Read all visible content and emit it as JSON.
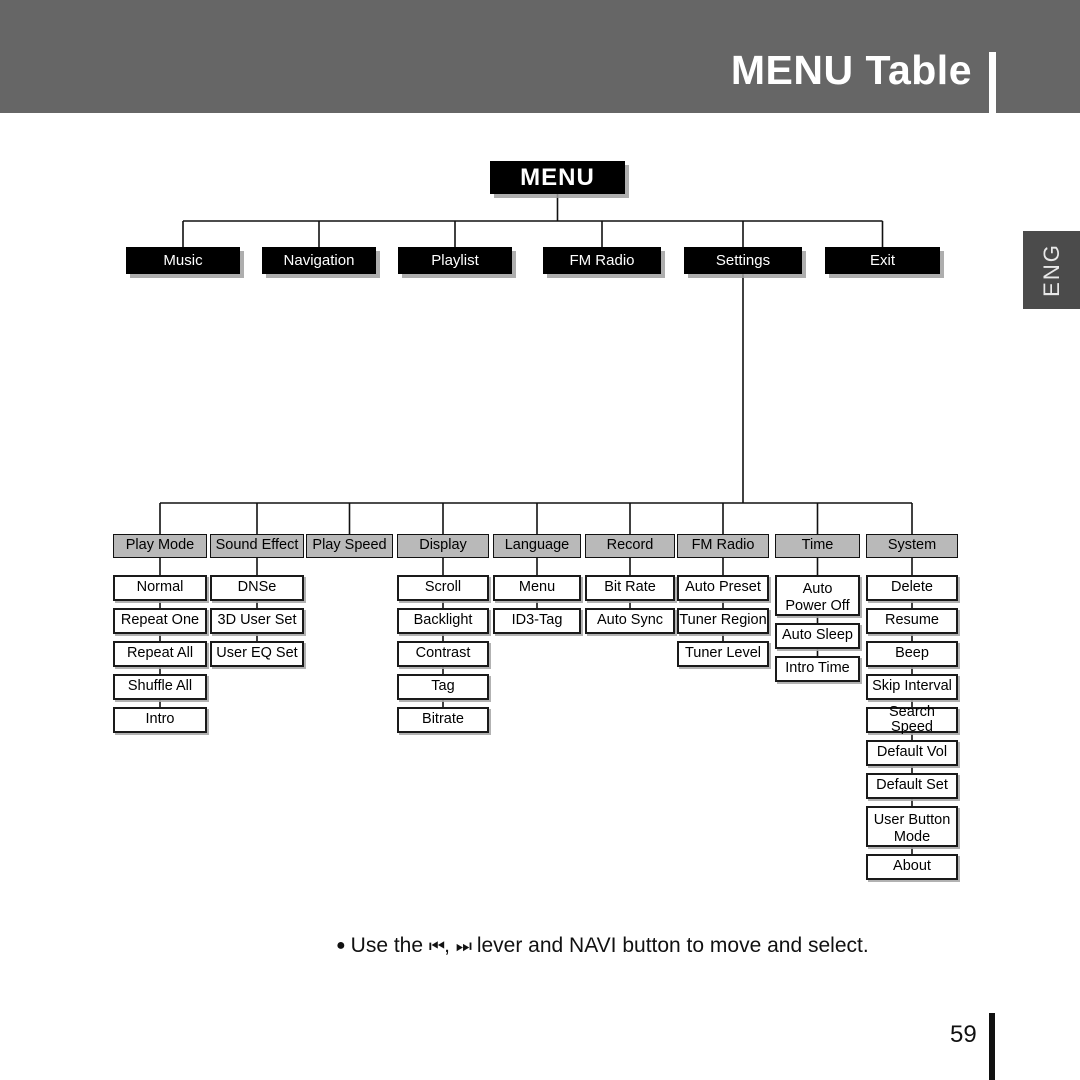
{
  "header": {
    "title": "MENU Table",
    "background_color": "#666666",
    "title_color": "#ffffff"
  },
  "side_tab": {
    "label": "ENG",
    "background_color": "#4b4b4b"
  },
  "footer": {
    "bullet": "●",
    "text_before": "Use the",
    "glyph_prev": "⏮",
    "separator": ",",
    "glyph_next": "⏭",
    "text_after": "lever and NAVI button to move and select.",
    "full_text": "● Use the ⏮ , ⏭ lever and NAVI button to move and select.",
    "page_number": "59"
  },
  "diagram": {
    "root": {
      "label": "MENU",
      "style": "black"
    },
    "level1": [
      {
        "label": "Music"
      },
      {
        "label": "Navigation"
      },
      {
        "label": "Playlist"
      },
      {
        "label": "FM Radio"
      },
      {
        "label": "Settings"
      },
      {
        "label": "Exit"
      }
    ],
    "settings_columns": [
      {
        "header": "Play Mode",
        "items": [
          "Normal",
          "Repeat One",
          "Repeat All",
          "Shuffle All",
          "Intro"
        ]
      },
      {
        "header": "Sound Effect",
        "items": [
          "DNSe",
          "3D User Set",
          "User EQ Set"
        ]
      },
      {
        "header": "Play Speed",
        "items": []
      },
      {
        "header": "Display",
        "items": [
          "Scroll",
          "Backlight",
          "Contrast",
          "Tag",
          "Bitrate"
        ]
      },
      {
        "header": "Language",
        "items": [
          "Menu",
          "ID3-Tag"
        ]
      },
      {
        "header": "Record",
        "items": [
          "Bit Rate",
          "Auto Sync"
        ]
      },
      {
        "header": "FM Radio",
        "items": [
          "Auto Preset",
          "Tuner Region",
          "Tuner Level"
        ]
      },
      {
        "header": "Time",
        "items": [
          "Auto\nPower Off",
          "Auto Sleep",
          "Intro Time"
        ]
      },
      {
        "header": "System",
        "items": [
          "Delete",
          "Resume",
          "Beep",
          "Skip Interval",
          "Search Speed",
          "Default Vol",
          "Default Set",
          "User Button\nMode",
          "About"
        ]
      }
    ]
  },
  "colors": {
    "header_gray": "#666666",
    "tab_gray": "#4b4b4b",
    "node_black": "#000000",
    "node_gray": "#b9b9b9",
    "node_white": "#ffffff",
    "line": "#111111"
  }
}
